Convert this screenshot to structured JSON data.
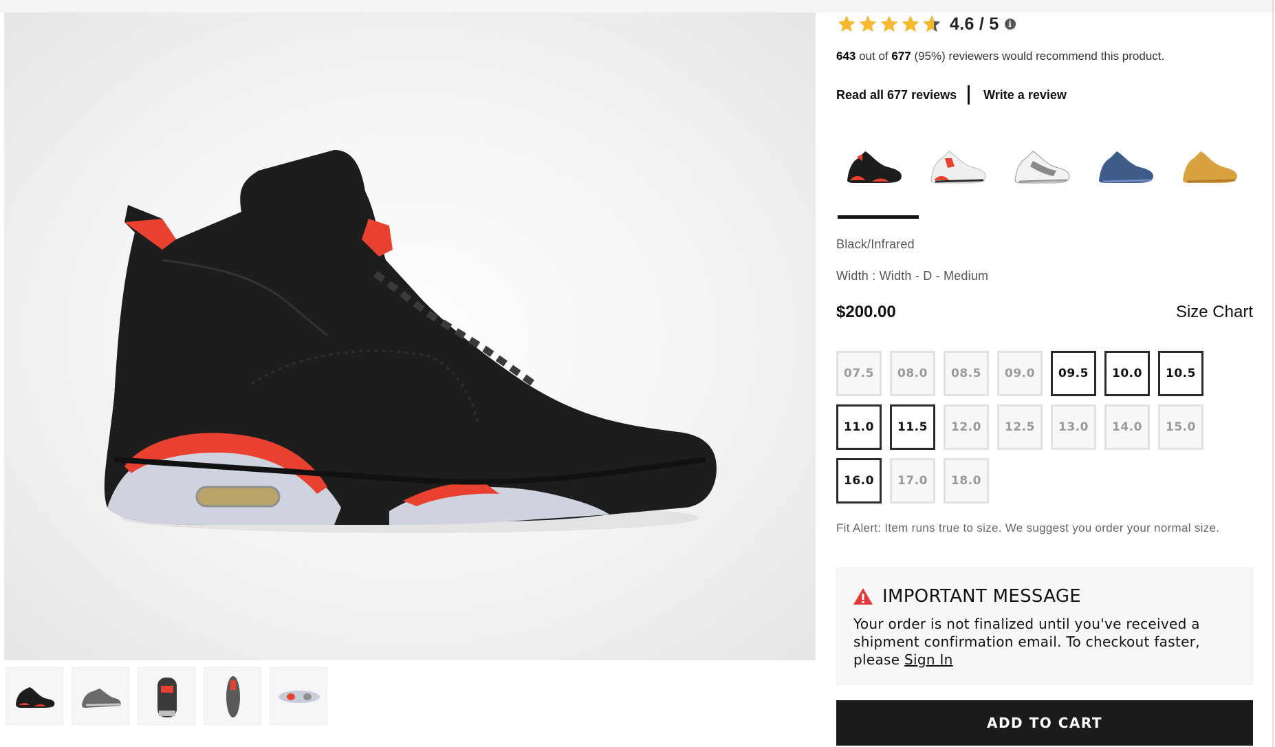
{
  "rating": {
    "value": 4.6,
    "text": "4.6 / 5",
    "info_icon": "info-icon",
    "star_color": "#f5b82e"
  },
  "recommend": {
    "count": "643",
    "mid": " out of ",
    "total": "677",
    "rest": " (95%) reviewers would recommend this product."
  },
  "reviews": {
    "read_all": "Read all 677 reviews",
    "write": "Write a review"
  },
  "swatches": [
    {
      "name": "black-infrared",
      "selected": true
    },
    {
      "name": "white-infrared",
      "selected": false
    },
    {
      "name": "white-grey",
      "selected": false
    },
    {
      "name": "navy",
      "selected": false
    },
    {
      "name": "wheat",
      "selected": false
    }
  ],
  "product": {
    "color": "Black/Infrared",
    "width": "Width : Width - D - Medium",
    "price": "$200.00",
    "size_chart": "Size Chart"
  },
  "sizes": [
    {
      "label": "07.5",
      "available": false
    },
    {
      "label": "08.0",
      "available": false
    },
    {
      "label": "08.5",
      "available": false
    },
    {
      "label": "09.0",
      "available": false
    },
    {
      "label": "09.5",
      "available": true
    },
    {
      "label": "10.0",
      "available": true
    },
    {
      "label": "10.5",
      "available": true
    },
    {
      "label": "11.0",
      "available": true
    },
    {
      "label": "11.5",
      "available": true
    },
    {
      "label": "12.0",
      "available": false
    },
    {
      "label": "12.5",
      "available": false
    },
    {
      "label": "13.0",
      "available": false
    },
    {
      "label": "14.0",
      "available": false
    },
    {
      "label": "15.0",
      "available": false
    },
    {
      "label": "16.0",
      "available": true
    },
    {
      "label": "17.0",
      "available": false
    },
    {
      "label": "18.0",
      "available": false
    }
  ],
  "fit_alert": "Fit Alert: Item runs true to size. We suggest you order your normal size.",
  "message": {
    "icon": "warning-icon",
    "title": "IMPORTANT MESSAGE",
    "body": "Your order is not finalized until you've received a shipment confirmation email. To checkout faster, please ",
    "link": "Sign In",
    "warning_color": "#e03a3a"
  },
  "cart": {
    "label": "ADD TO CART"
  },
  "thumbnails": [
    {
      "name": "side-view"
    },
    {
      "name": "medial-view"
    },
    {
      "name": "back-view"
    },
    {
      "name": "top-view"
    },
    {
      "name": "sole-view"
    }
  ]
}
